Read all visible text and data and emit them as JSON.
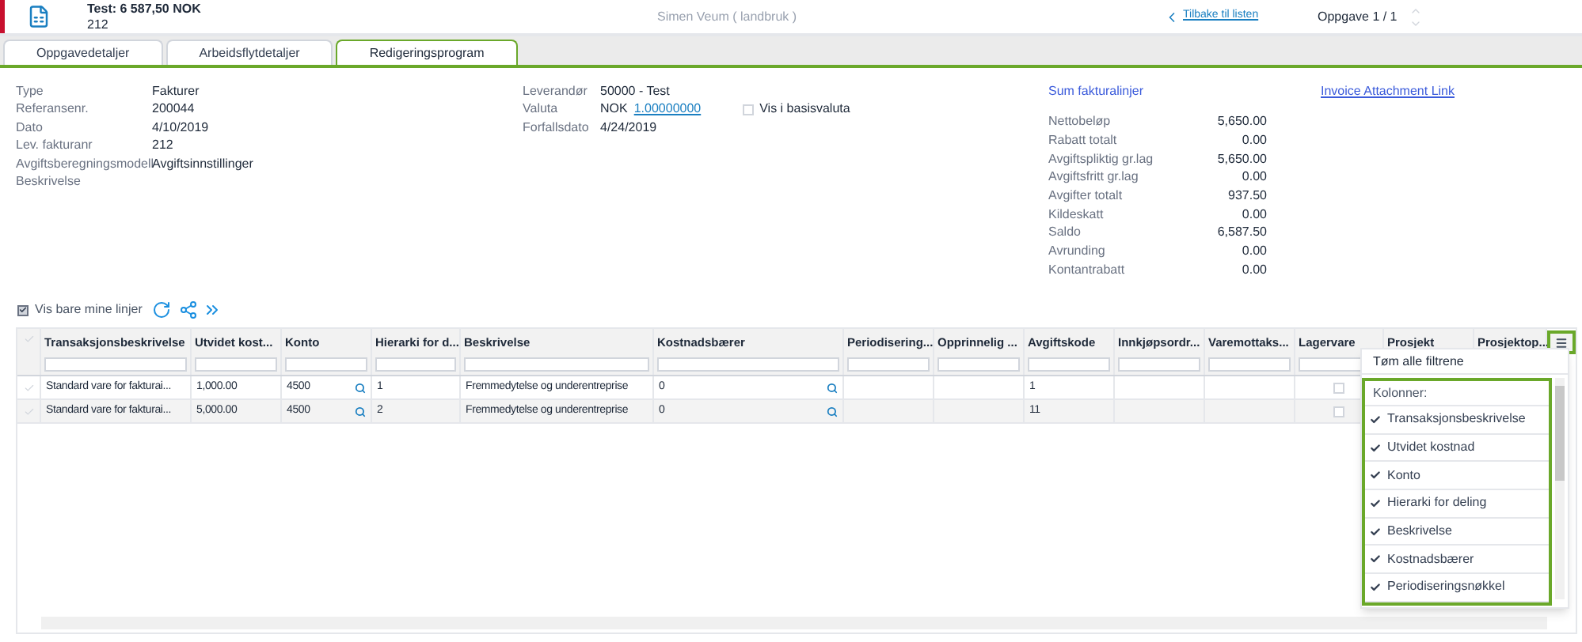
{
  "header": {
    "title": "Test: 6 587,50 NOK",
    "subtitle": "212",
    "user": "Simen Veum ( landbruk )",
    "back_link": "Tilbake til listen",
    "task_counter": "Oppgave 1 / 1"
  },
  "tabs": [
    {
      "label": "Oppgavedetaljer",
      "selected": false
    },
    {
      "label": "Arbeidsflytdetaljer",
      "selected": false
    },
    {
      "label": "Redigeringsprogram",
      "selected": true
    }
  ],
  "details": [
    {
      "label": "Type",
      "value": "Fakturer"
    },
    {
      "label": "Referansenr.",
      "value": "200044"
    },
    {
      "label": "Dato",
      "value": "4/10/2019"
    },
    {
      "label": "Lev. fakturanr",
      "value": "212"
    },
    {
      "label": "Avgiftsberegningsmodell",
      "value": "Avgiftsinnstillinger"
    },
    {
      "label": "Beskrivelse"
    }
  ],
  "supplier": {
    "supplier_label": "Leverandør",
    "supplier": "50000 - Test",
    "currency_label": "Valuta",
    "currency": "NOK",
    "rate": "1.00000000",
    "base_currency": {
      "label": "Vis i basisvaluta",
      "checked": false
    },
    "due_label": "Forfallsdato",
    "due": "4/24/2019"
  },
  "summary": {
    "title": "Sum fakturalinjer",
    "rows": [
      {
        "label": "Nettobeløp",
        "value": "5,650.00"
      },
      {
        "label": "Rabatt totalt",
        "value": "0.00"
      },
      {
        "label": "Avgiftspliktig gr.lag",
        "value": "5,650.00"
      },
      {
        "label": "Avgiftsfritt gr.lag",
        "value": "0.00"
      },
      {
        "label": "Avgifter totalt",
        "value": "937.50"
      },
      {
        "label": "Kildeskatt",
        "value": "0.00"
      },
      {
        "label": "Saldo",
        "value": "6,587.50"
      },
      {
        "label": "Avrunding",
        "value": "0.00"
      },
      {
        "label": "Kontantrabatt",
        "value": "0.00"
      }
    ]
  },
  "attachment_link": "Invoice Attachment Link",
  "toolbar": {
    "only_mine": {
      "label": "Vis bare mine linjer",
      "checked": true
    }
  },
  "grid": {
    "columns": [
      "Transaksjonsbeskrivelse",
      "Utvidet kost...",
      "Konto",
      "Hierarki for d...",
      "Beskrivelse",
      "Kostnadsbærer",
      "Periodisering...",
      "Opprinnelig ...",
      "Avgiftskode",
      "Innkjøpsordr...",
      "Varemottaks...",
      "Lagervare",
      "Prosjekt",
      "Prosjektop..."
    ],
    "rows": [
      {
        "selected": false,
        "description": "Standard vare for fakturai...",
        "extended_cost": "1,000.00",
        "account": "4500",
        "hierarchy": "1",
        "text": "Fremmedytelse og underentreprise",
        "cost_carrier": "0",
        "tax_code": "1",
        "stock_item": false
      },
      {
        "selected": false,
        "description": "Standard vare for fakturai...",
        "extended_cost": "5,000.00",
        "account": "4500",
        "hierarchy": "2",
        "text": "Fremmedytelse og underentreprise",
        "cost_carrier": "0",
        "tax_code": "11",
        "stock_item": false
      }
    ]
  },
  "column_menu": {
    "clear_filters": "Tøm alle filtrene",
    "heading": "Kolonner:",
    "items": [
      {
        "label": "Transaksjonsbeskrivelse",
        "checked": true
      },
      {
        "label": "Utvidet kostnad",
        "checked": true
      },
      {
        "label": "Konto",
        "checked": true
      },
      {
        "label": "Hierarki for deling",
        "checked": true
      },
      {
        "label": "Beskrivelse",
        "checked": true
      },
      {
        "label": "Kostnadsbærer",
        "checked": true
      },
      {
        "label": "Periodiseringsnøkkel",
        "checked": true
      }
    ]
  }
}
